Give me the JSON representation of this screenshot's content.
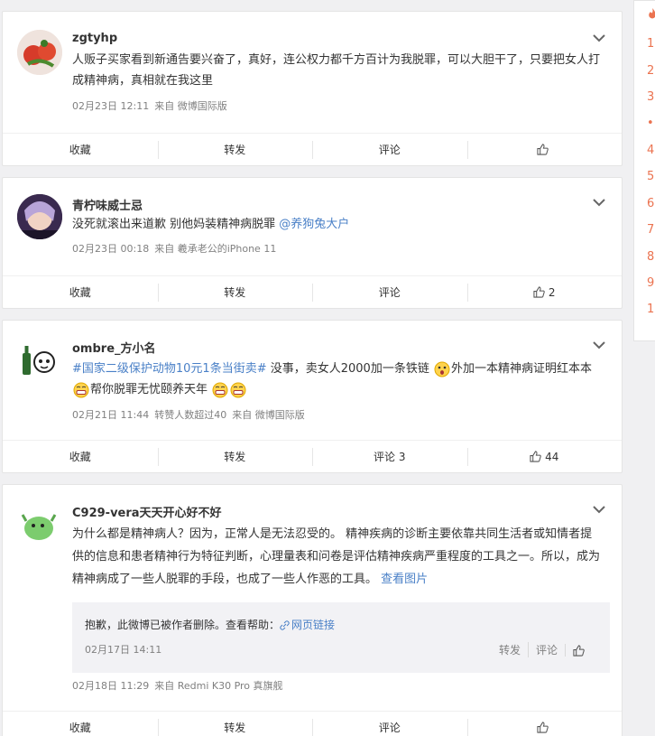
{
  "posts": [
    {
      "nick": "zgtyhp",
      "segments": [
        {
          "t": "人贩子买家看到新通告要兴奋了，真好，连公权力都千方百计为我脱罪，可以大胆干了，只要把女人打成精神病，真相就在我这里"
        }
      ],
      "date": "02月23日 12:11",
      "source": "来自 微博国际版",
      "actions": {
        "fav": "收藏",
        "share": "转发",
        "comment": "评论",
        "like": ""
      }
    },
    {
      "nick": "青柠味威士忌",
      "line": "没死就滚出来道歉 别他妈装精神病脱罪",
      "mention": "@养狗兔大户",
      "date": "02月23日 00:18",
      "source": "来自 羲承老公的iPhone 11",
      "actions": {
        "fav": "收藏",
        "share": "转发",
        "comment": "评论",
        "like": "2"
      }
    },
    {
      "nick": "ombre_方小名",
      "hashtag": "#国家二级保护动物10元1条当街卖#",
      "text1": " 没事，卖女人2000加一条铁链",
      "text2": "外加一本精神病证明红本本",
      "text3": "帮你脱罪无忧颐养天年",
      "date": "02月21日 11:44",
      "extra": "转赞人数超过40",
      "source": "来自 微博国际版",
      "actions": {
        "fav": "收藏",
        "share": "转发",
        "comment": "评论 3",
        "like": "44"
      }
    },
    {
      "nick": "C929-vera天天开心好不好",
      "text": "为什么都是精神病人？因为，正常人是无法忍受的。 精神疾病的诊断主要依靠共同生活者或知情者提供的信息和患者精神行为特征判断，心理量表和问卷是评估精神疾病严重程度的工具之一。所以，成为精神病成了一些人脱罪的手段，也成了一些人作恶的工具。",
      "view_pics": "查看图片",
      "quote": {
        "text": "抱歉，此微博已被作者删除。查看帮助：",
        "link": "网页链接",
        "date": "02月17日 14:11",
        "share": "转发",
        "comment": "评论"
      },
      "date": "02月18日 11:29",
      "source": "来自 Redmi K30 Pro 真旗舰",
      "actions": {
        "fav": "收藏",
        "share": "转发",
        "comment": "评论",
        "like": ""
      }
    }
  ],
  "sidebar": {
    "items": [
      "1",
      "2",
      "3",
      "•",
      "4",
      "5",
      "6",
      "7",
      "8",
      "9",
      "1"
    ]
  },
  "colors": {
    "accent": "#eb7350",
    "link": "#4a80c7"
  }
}
